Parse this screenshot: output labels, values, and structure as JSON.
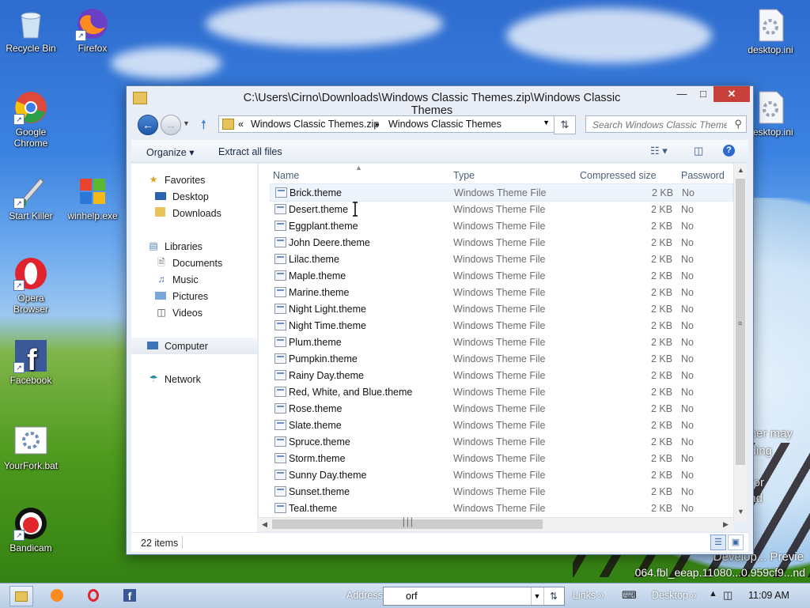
{
  "desktop": {
    "icons": [
      {
        "label": "Recycle Bin"
      },
      {
        "label": "Firefox"
      },
      {
        "label": "Google Chrome"
      },
      {
        "label": "Start Killer"
      },
      {
        "label": "winhelp.exe"
      },
      {
        "label": "Opera Browser"
      },
      {
        "label": "Facebook"
      },
      {
        "label": "YourFork.bat"
      },
      {
        "label": "Bandicam"
      },
      {
        "label": "desktop.ini"
      },
      {
        "label": "desktop.ini"
      }
    ],
    "watermark": {
      "line1": "Develop... Previe",
      "line2": "064.fbl_eeap.11080...0.959cf9...nd"
    },
    "behind_text": [
      "her may",
      "ding",
      "or",
      "nd"
    ]
  },
  "window": {
    "title": "C:\\Users\\Cirno\\Downloads\\Windows Classic Themes.zip\\Windows Classic Themes",
    "controls": {
      "minimize": "—",
      "maximize": "□",
      "close": "✕"
    },
    "address": {
      "overflow": "«",
      "segments": [
        "Windows Classic Themes.zip",
        "Windows Classic Themes"
      ],
      "separator": "▸"
    },
    "search_placeholder": "Search Windows Classic Themes",
    "toolbar": {
      "organize": "Organize ▾",
      "extract": "Extract all files"
    },
    "nav": {
      "favorites": "Favorites",
      "desktop": "Desktop",
      "downloads": "Downloads",
      "libraries": "Libraries",
      "documents": "Documents",
      "music": "Music",
      "pictures": "Pictures",
      "videos": "Videos",
      "computer": "Computer",
      "network": "Network"
    },
    "columns": {
      "name": "Name",
      "type": "Type",
      "size": "Compressed size",
      "password": "Password ..."
    },
    "files": [
      {
        "name": "Brick.theme",
        "type": "Windows Theme File",
        "size": "2 KB",
        "password": "No"
      },
      {
        "name": "Desert.theme",
        "type": "Windows Theme File",
        "size": "2 KB",
        "password": "No"
      },
      {
        "name": "Eggplant.theme",
        "type": "Windows Theme File",
        "size": "2 KB",
        "password": "No"
      },
      {
        "name": "John Deere.theme",
        "type": "Windows Theme File",
        "size": "2 KB",
        "password": "No"
      },
      {
        "name": "Lilac.theme",
        "type": "Windows Theme File",
        "size": "2 KB",
        "password": "No"
      },
      {
        "name": "Maple.theme",
        "type": "Windows Theme File",
        "size": "2 KB",
        "password": "No"
      },
      {
        "name": "Marine.theme",
        "type": "Windows Theme File",
        "size": "2 KB",
        "password": "No"
      },
      {
        "name": "Night Light.theme",
        "type": "Windows Theme File",
        "size": "2 KB",
        "password": "No"
      },
      {
        "name": "Night Time.theme",
        "type": "Windows Theme File",
        "size": "2 KB",
        "password": "No"
      },
      {
        "name": "Plum.theme",
        "type": "Windows Theme File",
        "size": "2 KB",
        "password": "No"
      },
      {
        "name": "Pumpkin.theme",
        "type": "Windows Theme File",
        "size": "2 KB",
        "password": "No"
      },
      {
        "name": "Rainy Day.theme",
        "type": "Windows Theme File",
        "size": "2 KB",
        "password": "No"
      },
      {
        "name": "Red, White, and Blue.theme",
        "type": "Windows Theme File",
        "size": "2 KB",
        "password": "No"
      },
      {
        "name": "Rose.theme",
        "type": "Windows Theme File",
        "size": "2 KB",
        "password": "No"
      },
      {
        "name": "Slate.theme",
        "type": "Windows Theme File",
        "size": "2 KB",
        "password": "No"
      },
      {
        "name": "Spruce.theme",
        "type": "Windows Theme File",
        "size": "2 KB",
        "password": "No"
      },
      {
        "name": "Storm.theme",
        "type": "Windows Theme File",
        "size": "2 KB",
        "password": "No"
      },
      {
        "name": "Sunny Day.theme",
        "type": "Windows Theme File",
        "size": "2 KB",
        "password": "No"
      },
      {
        "name": "Sunset.theme",
        "type": "Windows Theme File",
        "size": "2 KB",
        "password": "No"
      },
      {
        "name": "Teal.theme",
        "type": "Windows Theme File",
        "size": "2 KB",
        "password": "No"
      }
    ],
    "status": "22 items"
  },
  "taskbar": {
    "address_label": "Address",
    "address_value": "orf",
    "links": "Links »",
    "desktop": "Desktop »",
    "clock": "11:09 AM"
  },
  "colors": {
    "accent": "#1d57a9",
    "close": "#c7403a"
  }
}
